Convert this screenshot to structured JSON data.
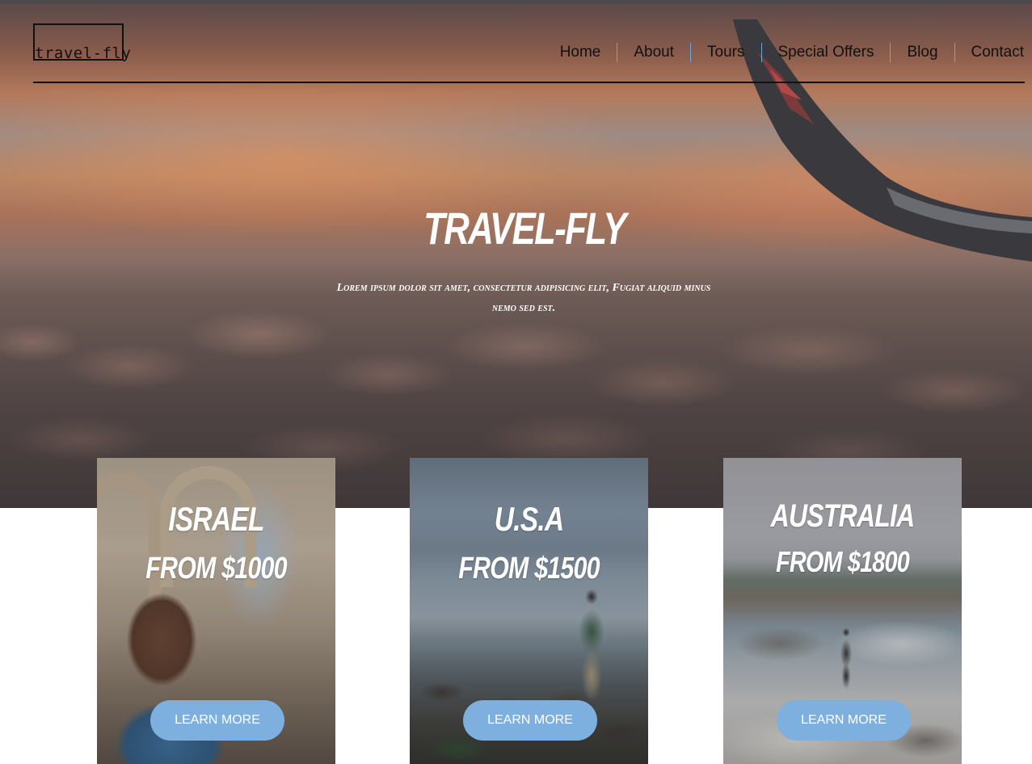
{
  "brand": {
    "logo_text": "travel-fly"
  },
  "nav": {
    "items": [
      {
        "label": "Home"
      },
      {
        "label": "About"
      },
      {
        "label": "Tours"
      },
      {
        "label": "Special Offers"
      },
      {
        "label": "Blog"
      },
      {
        "label": "Contact"
      }
    ]
  },
  "hero": {
    "title": "TRAVEL-FLY",
    "subtitle": "Lorem ipsum dolor sit amet, consectetur adipisicing elit, Fugiat aliquid minus nemo sed est."
  },
  "tours": [
    {
      "country": "ISRAEL",
      "price": "FROM $1000",
      "button": "LEARN MORE"
    },
    {
      "country": "U.S.A",
      "price": "FROM $1500",
      "button": "LEARN MORE"
    },
    {
      "country": "AUSTRALIA",
      "price": "FROM $1800",
      "button": "LEARN MORE"
    }
  ],
  "colors": {
    "button": "#7eb0df",
    "nav_divider": "#6fa8d8",
    "text_dark": "#111111",
    "text_light": "#ffffff"
  }
}
